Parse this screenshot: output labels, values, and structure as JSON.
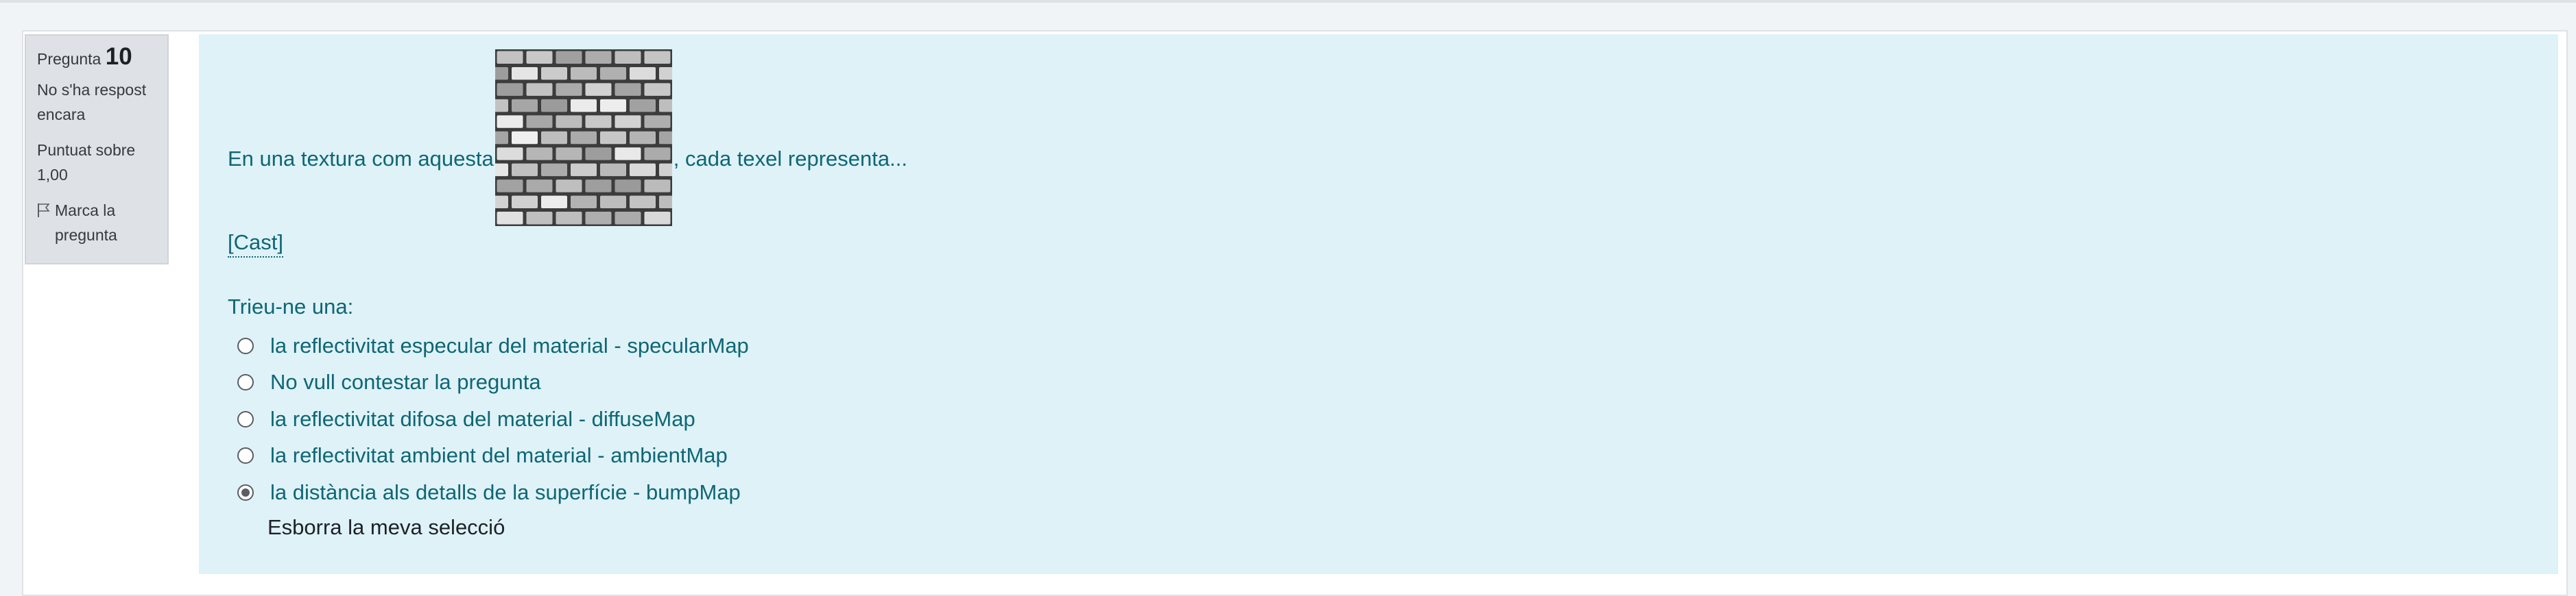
{
  "question_info": {
    "label": "Pregunta",
    "number": "10",
    "state": "No s'ha respost encara",
    "grade": "Puntuat sobre 1,00",
    "flag_label": "Marca la pregunta"
  },
  "question": {
    "text_before": "En una textura com aquesta",
    "text_after": ", cada texel representa...",
    "image_icon": "brick-texture-image",
    "cast_link": "[Cast]",
    "prompt": "Trieu-ne una:",
    "options": [
      {
        "label": "la reflectivitat especular del material - specularMap",
        "checked": false
      },
      {
        "label": "No vull contestar la pregunta",
        "checked": false
      },
      {
        "label": "la reflectivitat difosa del material - diffuseMap",
        "checked": false
      },
      {
        "label": "la reflectivitat ambient del material - ambientMap",
        "checked": false
      },
      {
        "label": "la distància als detalls de la superfície - bumpMap",
        "checked": true
      }
    ],
    "clear_label": "Esborra la meva selecció"
  },
  "colors": {
    "content_bg": "#def2f8",
    "content_text": "#0f6674",
    "info_bg": "#dee2e6"
  }
}
